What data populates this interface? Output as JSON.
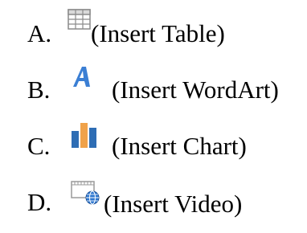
{
  "options": [
    {
      "letter": "A.",
      "label": "(Insert Table)",
      "icon": "table-icon"
    },
    {
      "letter": "B.",
      "label": "(Insert WordArt)",
      "icon": "wordart-icon"
    },
    {
      "letter": "C.",
      "label": "(Insert Chart)",
      "icon": "chart-icon"
    },
    {
      "letter": "D.",
      "label": "(Insert Video)",
      "icon": "video-icon"
    }
  ],
  "colors": {
    "table_outline": "#8a8a8a",
    "wordart_blue": "#3b7fd4",
    "chart_orange": "#f0a24a",
    "chart_blue": "#2e6db4",
    "video_frame": "#9a9a9a",
    "globe_blue": "#2f78d0"
  }
}
